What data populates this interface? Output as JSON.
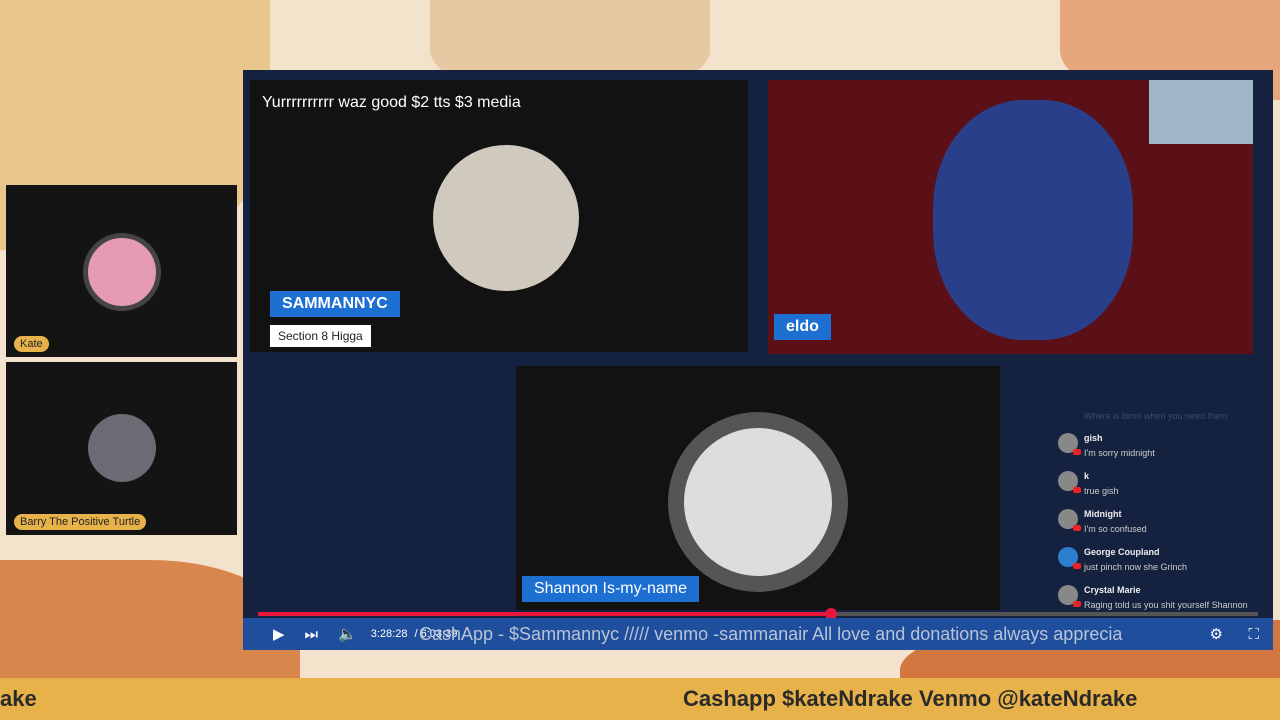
{
  "side_panels": [
    {
      "name": "Kate"
    },
    {
      "name": "Barry The Positive Turtle"
    }
  ],
  "video": {
    "title": "Yurrrrrrrrrr waz good $2 tts $3 media",
    "tiles": [
      {
        "name": "SAMMANNYC",
        "subtitle": "Section 8 Higga"
      },
      {
        "name": "eldo"
      },
      {
        "name": "Shannon Is-my-name"
      }
    ],
    "chat": {
      "faded": "Where is bimo when you need them",
      "messages": [
        {
          "user": "gish",
          "text": "I'm sorry midnight"
        },
        {
          "user": "k",
          "text": "true gish"
        },
        {
          "user": "Midnight",
          "text": "I'm so confused"
        },
        {
          "user": "George Coupland",
          "text": "just pinch now she Grinch"
        },
        {
          "user": "Crystal Marie",
          "text": "Raging told us you shit yourself Shannon"
        }
      ]
    },
    "player": {
      "current_time": "3:28:28",
      "duration": "6:03:39",
      "progress": 0.573,
      "ticker": "CashApp - $Sammannyc ///// venmo -sammanair All love and donations always apprecia"
    }
  },
  "banner": {
    "left": "ake",
    "right": "Cashapp $kateNdrake Venmo @kateNdrake"
  }
}
